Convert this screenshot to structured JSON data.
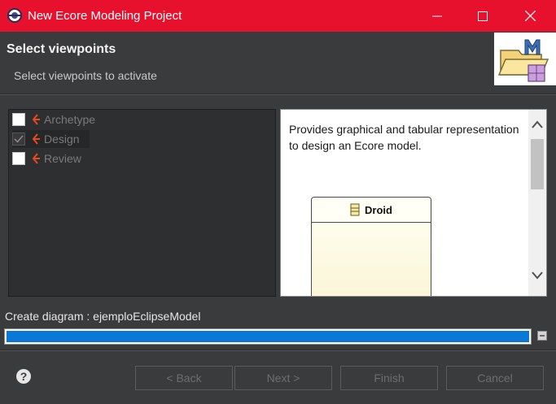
{
  "window": {
    "title": "New Ecore Modeling Project"
  },
  "header": {
    "title": "Select viewpoints",
    "subtitle": "Select viewpoints to activate"
  },
  "viewpoints": [
    {
      "label": "Archetype",
      "checked": false
    },
    {
      "label": "Design",
      "checked": true
    },
    {
      "label": "Review",
      "checked": false
    }
  ],
  "description": {
    "text": "Provides graphical and tabular representation to design an Ecore model.",
    "preview_class": "Droid"
  },
  "progress": {
    "label": "Create diagram : ejemploEclipseModel",
    "percent": 100
  },
  "buttons": {
    "back": "< Back",
    "next": "Next >",
    "finish": "Finish",
    "cancel": "Cancel"
  },
  "colors": {
    "titlebar": "#e8112d",
    "progress": "#0a78d6",
    "viewpoint_icon": "#e8491d"
  },
  "icons": {
    "app": "eclipse-gear-icon",
    "wizard": "modeling-project-wizard-icon",
    "viewpoint": "sirius-viewpoint-icon",
    "class": "eclass-icon",
    "help": "help-icon",
    "stop": "stop-icon"
  }
}
